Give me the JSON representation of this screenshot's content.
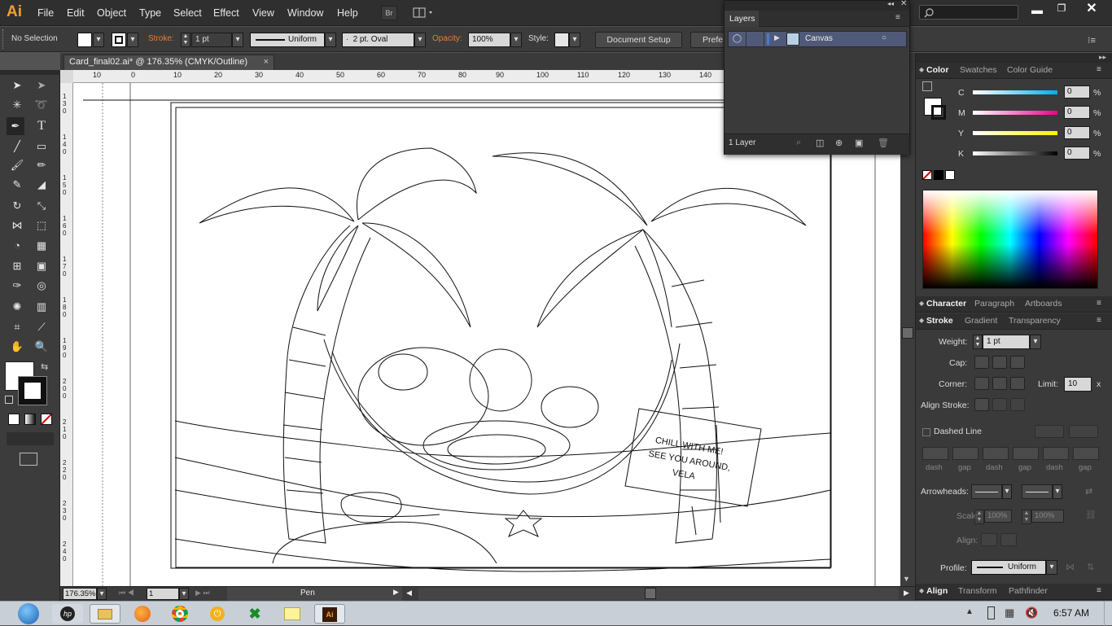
{
  "app": {
    "logo": "Ai"
  },
  "menu": [
    "File",
    "Edit",
    "Object",
    "Type",
    "Select",
    "Effect",
    "View",
    "Window",
    "Help"
  ],
  "bridge_label": "Br",
  "control": {
    "selection": "No Selection",
    "stroke_label": "Stroke:",
    "stroke_weight": "1 pt",
    "profile": "Uniform",
    "brush": "2 pt. Oval",
    "opacity_label": "Opacity:",
    "opacity": "100%",
    "style_label": "Style:",
    "doc_setup": "Document Setup",
    "prefs": "Prefe"
  },
  "tab": {
    "title": "Card_final02.ai* @ 176.35% (CMYK/Outline)",
    "close": "×"
  },
  "ruler_h": [
    "10",
    "0",
    "10",
    "20",
    "30",
    "40",
    "50",
    "60",
    "70",
    "80",
    "90",
    "100",
    "110",
    "120",
    "130",
    "140"
  ],
  "ruler_v": [
    "130",
    "140",
    "150",
    "160",
    "170",
    "180",
    "190",
    "200",
    "210",
    "220",
    "230",
    "240"
  ],
  "status": {
    "zoom": "176.35%",
    "page": "1",
    "tool": "Pen"
  },
  "layers": {
    "title": "Layers",
    "layer_name": "Canvas",
    "count": "1 Layer"
  },
  "color_panel": {
    "tabs": [
      "Color",
      "Swatches",
      "Color Guide"
    ],
    "channels": [
      {
        "label": "C",
        "value": "0",
        "unit": "%"
      },
      {
        "label": "M",
        "value": "0",
        "unit": "%"
      },
      {
        "label": "Y",
        "value": "0",
        "unit": "%"
      },
      {
        "label": "K",
        "value": "0",
        "unit": "%"
      }
    ]
  },
  "char_tabs": [
    "Character",
    "Paragraph",
    "Artboards"
  ],
  "stroke_tabs": [
    "Stroke",
    "Gradient",
    "Transparency"
  ],
  "stroke": {
    "weight_label": "Weight:",
    "weight": "1 pt",
    "cap_label": "Cap:",
    "corner_label": "Corner:",
    "limit_label": "Limit:",
    "limit": "10",
    "limit_unit": "x",
    "align_label": "Align Stroke:",
    "dashed": "Dashed Line",
    "dash_labels": [
      "dash",
      "gap",
      "dash",
      "gap",
      "dash",
      "gap"
    ],
    "arrowheads_label": "Arrowheads:",
    "scale_label": "Scale:",
    "scale1": "100%",
    "scale2": "100%",
    "align2_label": "Align:",
    "profile_label": "Profile:",
    "profile": "Uniform"
  },
  "align_tabs": [
    "Align",
    "Transform",
    "Pathfinder"
  ],
  "taskbar": {
    "time": "6:57 AM"
  },
  "colors": {
    "accent": "#4a7bd0",
    "stroke_orange": "#e0803a",
    "ai_orange": "#f0a030"
  }
}
